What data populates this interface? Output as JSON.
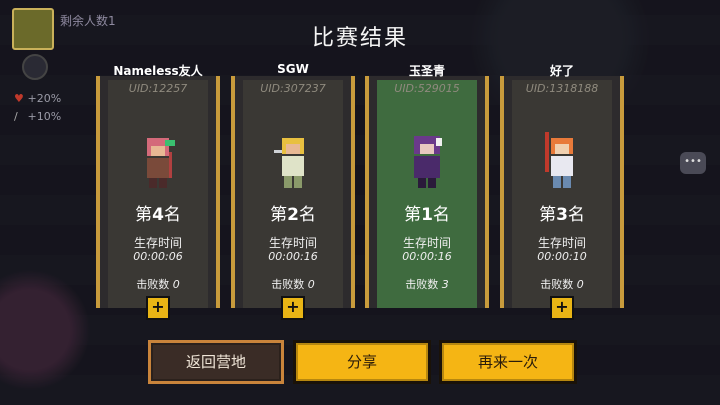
{
  "hud": {
    "remaining_label": "剩余人数1",
    "stats": [
      "+20%",
      "+10%"
    ]
  },
  "title": "比赛结果",
  "players": [
    {
      "name": "Nameless友人",
      "uid": "UID:12257",
      "rank_prefix": "第",
      "rank_num": "4",
      "rank_suffix": "名",
      "survive_label": "生存时间",
      "survive_time": "00:00:06",
      "kills_label": "击败数",
      "kills": "0",
      "highlight": false,
      "add_label": "+"
    },
    {
      "name": "SGW",
      "uid": "UID:307237",
      "rank_prefix": "第",
      "rank_num": "2",
      "rank_suffix": "名",
      "survive_label": "生存时间",
      "survive_time": "00:00:16",
      "kills_label": "击败数",
      "kills": "0",
      "highlight": false,
      "add_label": "+"
    },
    {
      "name": "玉圣青",
      "uid": "UID:529015",
      "rank_prefix": "第",
      "rank_num": "1",
      "rank_suffix": "名",
      "survive_label": "生存时间",
      "survive_time": "00:00:16",
      "kills_label": "击败数",
      "kills": "3",
      "highlight": true,
      "add_label": ""
    },
    {
      "name": "好了",
      "uid": "UID:1318188",
      "rank_prefix": "第",
      "rank_num": "3",
      "rank_suffix": "名",
      "survive_label": "生存时间",
      "survive_time": "00:00:10",
      "kills_label": "击败数",
      "kills": "0",
      "highlight": false,
      "add_label": "+"
    }
  ],
  "buttons": {
    "back": "返回营地",
    "share": "分享",
    "again": "再来一次"
  },
  "chat_icon": "chat-bubble-icon",
  "colors": {
    "accent_yellow": "#f5b514",
    "winner_green": "#3f6b3f",
    "frame_gold": "#c89b3c"
  }
}
